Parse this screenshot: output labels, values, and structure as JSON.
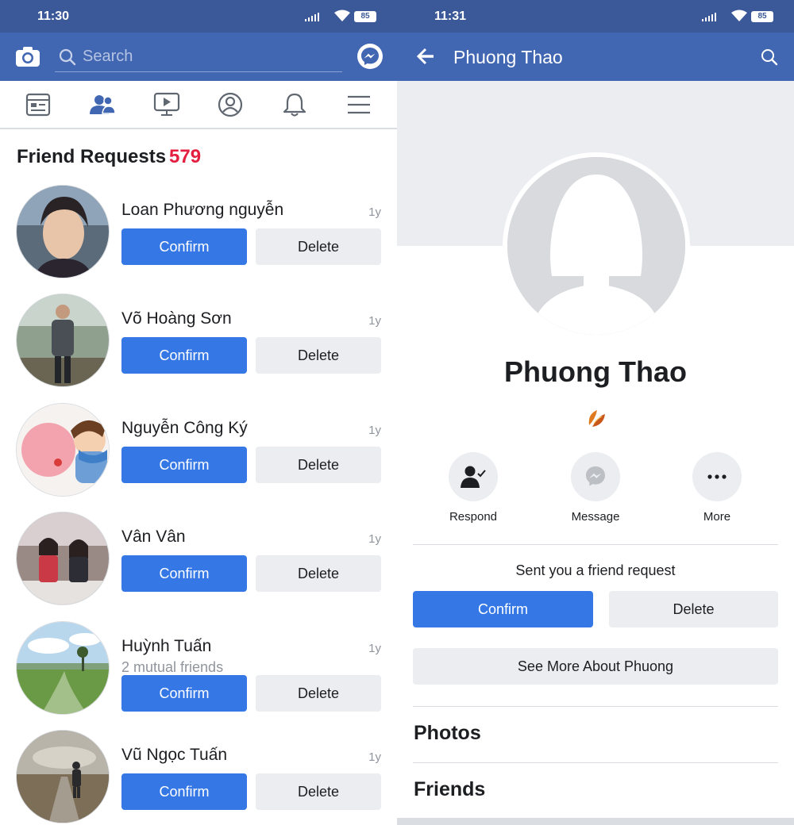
{
  "left": {
    "status": {
      "time": "11:30",
      "battery": "85"
    },
    "search": {
      "placeholder": "Search"
    },
    "tabs": [
      "news-feed",
      "friends",
      "watch",
      "profile",
      "notifications",
      "menu"
    ],
    "friend_requests": {
      "title": "Friend Requests",
      "count": "579",
      "confirm_label": "Confirm",
      "delete_label": "Delete",
      "items": [
        {
          "name": "Loan Phương nguyễn",
          "age": "1y",
          "mutual": ""
        },
        {
          "name": "Võ Hoàng Sơn",
          "age": "1y",
          "mutual": ""
        },
        {
          "name": "Nguyễn Công Ký",
          "age": "1y",
          "mutual": ""
        },
        {
          "name": "Vân Vân",
          "age": "1y",
          "mutual": ""
        },
        {
          "name": "Huỳnh Tuấn",
          "age": "1y",
          "mutual": "2 mutual friends"
        },
        {
          "name": "Vũ Ngọc Tuấn",
          "age": "1y",
          "mutual": ""
        }
      ]
    }
  },
  "right": {
    "status": {
      "time": "11:31",
      "battery": "85"
    },
    "header_title": "Phuong Thao",
    "profile_name": "Phuong Thao",
    "actions": {
      "respond": "Respond",
      "message": "Message",
      "more": "More"
    },
    "sent_text": "Sent you a friend request",
    "confirm_label": "Confirm",
    "delete_label": "Delete",
    "see_more_label": "See More About Phuong",
    "sections": {
      "photos": "Photos",
      "friends": "Friends"
    }
  },
  "colors": {
    "header": "#4267b2",
    "statusbar": "#3b5998",
    "accent": "#3578e5",
    "count_red": "#e41e3f"
  }
}
